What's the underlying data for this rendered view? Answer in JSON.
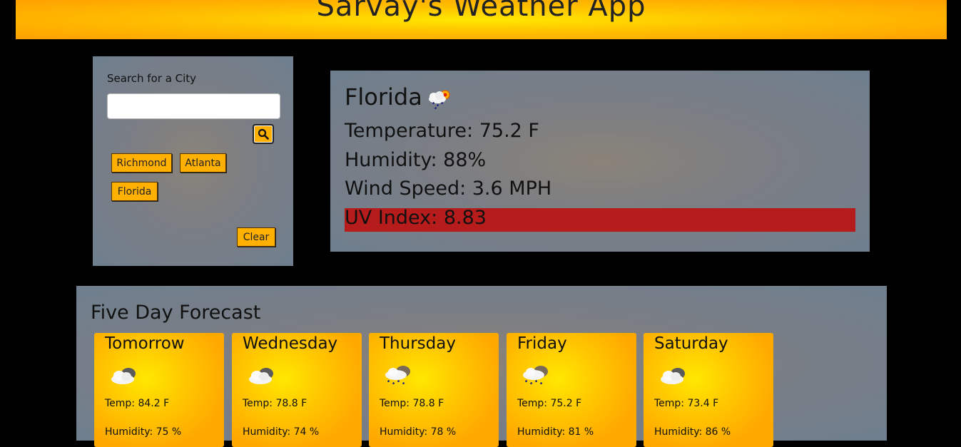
{
  "header": {
    "title": "Sarvay's Weather App"
  },
  "search": {
    "label": "Search for a City",
    "input_value": "",
    "placeholder": "",
    "search_icon": "search-icon",
    "clear_label": "Clear"
  },
  "history": {
    "items": [
      "Richmond",
      "Atlanta",
      "Florida"
    ]
  },
  "current": {
    "city": "Florida",
    "icon": "rain-sun-icon",
    "temperature": "Temperature: 75.2 F",
    "humidity": "Humidity: 88%",
    "wind": "Wind Speed: 3.6 MPH",
    "uv": "UV Index: 8.83",
    "uv_color": "#b71c1c"
  },
  "forecast": {
    "title": "Five Day Forecast",
    "days": [
      {
        "day": "Tomorrow",
        "icon": "cloud-icon",
        "temp": "Temp: 84.2 F",
        "humidity": "Humidity: 75 %"
      },
      {
        "day": "Wednesday",
        "icon": "cloud-icon",
        "temp": "Temp: 78.8 F",
        "humidity": "Humidity: 74 %"
      },
      {
        "day": "Thursday",
        "icon": "rain-cloud-icon",
        "temp": "Temp: 78.8 F",
        "humidity": "Humidity: 78 %"
      },
      {
        "day": "Friday",
        "icon": "rain-cloud-icon",
        "temp": "Temp: 75.2 F",
        "humidity": "Humidity: 81 %"
      },
      {
        "day": "Saturday",
        "icon": "cloud-icon",
        "temp": "Temp: 73.4 F",
        "humidity": "Humidity: 86 %"
      }
    ]
  },
  "colors": {
    "accent": "#ffb000",
    "panel": "#6f7f8f",
    "background": "#000000"
  }
}
